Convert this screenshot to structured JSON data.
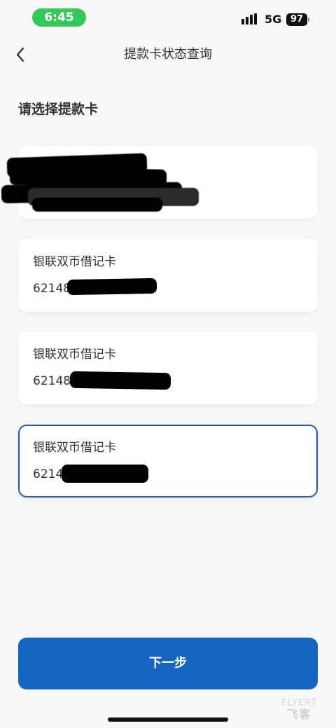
{
  "status_bar": {
    "time": "6:45",
    "network": "5G",
    "battery": "97"
  },
  "nav": {
    "title": "提款卡状态查询",
    "back_icon": "chevron-left-icon"
  },
  "section": {
    "title": "请选择提款卡"
  },
  "cards": [
    {
      "type": "",
      "number": "",
      "selected": false
    },
    {
      "type": "银联双币借记卡",
      "number": "62148",
      "selected": false
    },
    {
      "type": "银联双币借记卡",
      "number": "62148",
      "selected": false
    },
    {
      "type": "银联双币借记卡",
      "number": "6214",
      "selected": true
    }
  ],
  "footer": {
    "next_label": "下一步"
  },
  "watermark": {
    "brand": "FLYERT",
    "sub": "飞客"
  },
  "colors": {
    "accent": "#1565c0",
    "selected_border": "#1e5fa8",
    "time_pill": "#34c759"
  }
}
